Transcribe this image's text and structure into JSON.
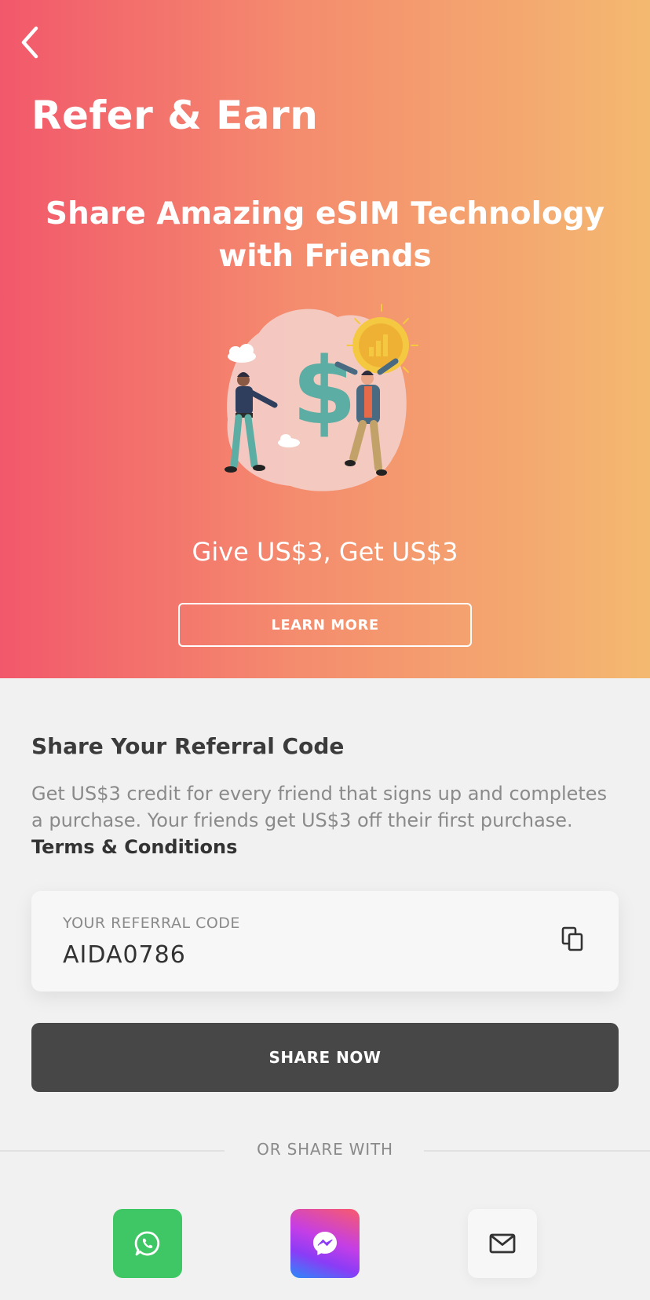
{
  "header": {
    "back_icon": "chevron-left-icon",
    "title": "Refer & Earn"
  },
  "hero": {
    "heading": "Share Amazing eSIM Technology with Friends",
    "offer": "Give US$3, Get US$3",
    "learn_more_label": "LEARN MORE",
    "colors": {
      "gradient_start": "#f2586b",
      "gradient_end": "#f4b970"
    }
  },
  "referral": {
    "section_title": "Share Your Referral Code",
    "description": "Get US$3 credit for every friend that signs up and completes a purchase. Your friends get US$3 off their first purchase.",
    "terms_link": "Terms & Conditions",
    "code_label": "YOUR REFERRAL CODE",
    "code_value": "AIDA0786",
    "copy_icon": "copy-icon"
  },
  "share": {
    "share_now_label": "SHARE NOW",
    "or_share_with": "OR SHARE WITH",
    "options": [
      {
        "name": "whatsapp",
        "icon": "whatsapp-icon",
        "color": "#3ec764"
      },
      {
        "name": "messenger",
        "icon": "messenger-icon",
        "color": "#a43cf0"
      },
      {
        "name": "email",
        "icon": "mail-icon",
        "color": "#f7f7f7"
      }
    ]
  }
}
